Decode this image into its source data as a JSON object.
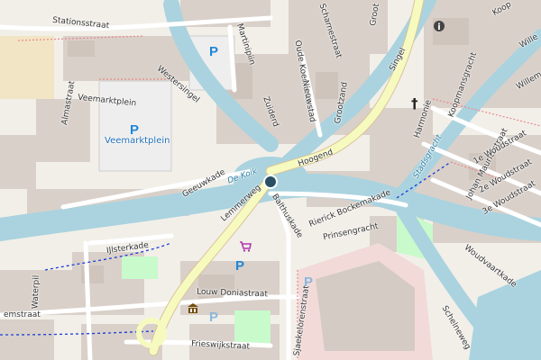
{
  "map": {
    "colors": {
      "background": "#f2efe9",
      "water": "#aad3df",
      "residential_block": "#d9d0c9",
      "building": "#d4cbc4",
      "parking": "#eeeeee",
      "primary_road": "#fcd6a4",
      "secondary_road": "#f7fabf",
      "minor_road": "#ffffff",
      "green": "#c8facc",
      "commercial": "#f2dad9",
      "poi_blue": "#1f86d6",
      "cycleway": "#1a3cd6",
      "footway": "#e9898b"
    },
    "streets": [
      {
        "id": "stationsstraat",
        "label": "Stationsstraat"
      },
      {
        "id": "westersingel",
        "label": "Westersingel"
      },
      {
        "id": "martinipiin",
        "label": "Martinipiin"
      },
      {
        "id": "oude-koemarkt",
        "label": "Oude Koemarkt"
      },
      {
        "id": "scharnestraat",
        "label": "Scharnestraat"
      },
      {
        "id": "groot",
        "label": "Groot"
      },
      {
        "id": "nieuwstad",
        "label": "Nieuwstad"
      },
      {
        "id": "grootzand",
        "label": "Grootzand"
      },
      {
        "id": "singel",
        "label": "Singel"
      },
      {
        "id": "koopmansgracht",
        "label": "Koopmansgracht"
      },
      {
        "id": "harmonie",
        "label": "Harmonie"
      },
      {
        "id": "almastraat",
        "label": "Almastraat"
      },
      {
        "id": "veemarktplein",
        "label": "Veemarktplein"
      },
      {
        "id": "zuiderd",
        "label": "Zuiderd"
      },
      {
        "id": "hoogend",
        "label": "Hoogend"
      },
      {
        "id": "geeuwkade",
        "label": "Geeuwkade"
      },
      {
        "id": "lemmerweg",
        "label": "Lemmerweg"
      },
      {
        "id": "balthuskade",
        "label": "Balthuskade"
      },
      {
        "id": "rierick-bockemakade",
        "label": "Rierick Bockemakade"
      },
      {
        "id": "prinsengracht",
        "label": "Prinsengracht"
      },
      {
        "id": "ijlsterkade",
        "label": "IJlsterkade"
      },
      {
        "id": "john-mauritsstraat",
        "label": "Johan Mauritsstraat"
      },
      {
        "id": "woudstraat-1",
        "label": "1e Woudstraat"
      },
      {
        "id": "woudstraat-2",
        "label": "2e Woudstraat"
      },
      {
        "id": "woudstraat-3",
        "label": "3e Woudstraat"
      },
      {
        "id": "woudvaartkade",
        "label": "Woudvaartkade"
      },
      {
        "id": "waterpil",
        "label": "Waterpil"
      },
      {
        "id": "louw-doniastraat",
        "label": "Louw Doniastraat"
      },
      {
        "id": "sjaekelorenstraat",
        "label": "Sjaekelorenstraat"
      },
      {
        "id": "frieswijkstraat",
        "label": "Frieswijkstraat"
      },
      {
        "id": "emstraat",
        "label": "emstraat"
      },
      {
        "id": "schelneweg",
        "label": "Schelneweg"
      },
      {
        "id": "koop",
        "label": "Koop"
      },
      {
        "id": "wille",
        "label": "Wille"
      },
      {
        "id": "willem",
        "label": "Willem"
      }
    ],
    "water_labels": [
      {
        "id": "de-kolk",
        "label": "De Kolk"
      },
      {
        "id": "stadsgracht",
        "label": "Stadsgracht"
      }
    ],
    "pois": [
      {
        "id": "veemarktplein-parking",
        "label": "Veemarktplein"
      }
    ],
    "markers": {
      "parking_symbol": "P",
      "info_symbol": "i",
      "church_symbol": "†",
      "place_marker": "location-pin"
    }
  }
}
